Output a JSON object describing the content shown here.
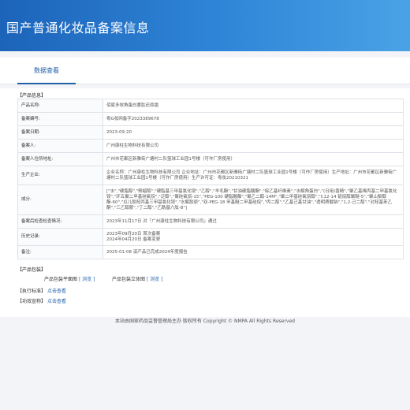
{
  "header": {
    "title": "国产普通化妆品备案信息"
  },
  "tab": {
    "label": "数据查看"
  },
  "product_info": {
    "section_title": "【产品信息】",
    "rows": [
      {
        "label": "产品名称:",
        "value": "佰宸多效角蛋白寡肽还原霜"
      },
      {
        "label": "备案编号:",
        "value": "粤G妆网备字2023389678"
      },
      {
        "label": "备案日期:",
        "value": "2023-09-20"
      },
      {
        "label": "备案人:",
        "value": "广州康柱生物科技有限公司"
      },
      {
        "label": "备案人住所地址:",
        "value": "广州市花都区新雅街广塘村二队篮球工业园1号楼（可作厂房使用）"
      },
      {
        "label": "生产企业:",
        "value": "企业名称：广州康柱生物科技有限公司 企业地址：广州市花都区新雅街广塘村二队篮球工业园1号楼（可作厂房使用）生产地址：广州市花都区新雅街广塘村二队篮球工业园1号楼（可作厂房使用）生产许可证：粤妆20210321"
      },
      {
        "label": "成分:",
        "value": "[\"水\",\"硬脂醇\",\"鲸蜡醇\",\"硬脂基三甲基氯化铵\",\"乙醇\",\"羊毛酯\",\"甘油硬脂酸酯\",\"棕乙基纤维素\",\"水解角蛋白\",\"(日用)香精\",\"聚乙基烯丙基二甲基氯化铵\",\"环五聚二甲基硅氧烷\",\"泛醇\",\"聚硅氧烷-15\",\"PEG-100 硬脂酸酯\",\"聚乙二醇-14M\",\"聚二甲基硅氧烷醇\",\"C12-14 链烷醇聚醚-5\",\"聚山梨醇酯-60\",\"瓜儿胶羟丙基三甲基氯化铵\",\"水解胶原\",\"双-PEG-18 甲基醚二甲基硅烷\",\"丙二醇\",\"乙基己基甘油\",\"透明质酸钠\",\"1,2-己二醇\",\"对羟基苯乙酮\",\"三乙醇胺\",\"丁二醇\",\"乙酰基六肽-8\"]"
      },
      {
        "label": "备案后检查检查情况:",
        "value": "2023年11月17日 对「广州康柱生物科技有限公司」通过"
      },
      {
        "label": "历史记录:",
        "value": "2023年09月20日 首次备案\n2024年04月20日 备案变更"
      },
      {
        "label": "备注:",
        "value": "2025-01-08 该产品已完成2024年度报告"
      }
    ]
  },
  "packaging": {
    "section_title": "【产品包装】",
    "plane_label": "产品包装平面图",
    "plane_link": "[ 浏览 ]",
    "solid_label": "产品包装立体图",
    "solid_link": "[ 浏览 ]"
  },
  "standard": {
    "label": "【执行标准】",
    "link": "点击查看"
  },
  "efficacy": {
    "label": "【功效宣称】",
    "link": "点击查看"
  },
  "footer": {
    "text": "本站由国家药品监督管理局主办 版权所有 Copyright © NMPA All Rights Reserved"
  },
  "colors": {
    "header_start": "#1c64b9",
    "header_end": "#4aa2e6",
    "link": "#1f5fa8"
  }
}
